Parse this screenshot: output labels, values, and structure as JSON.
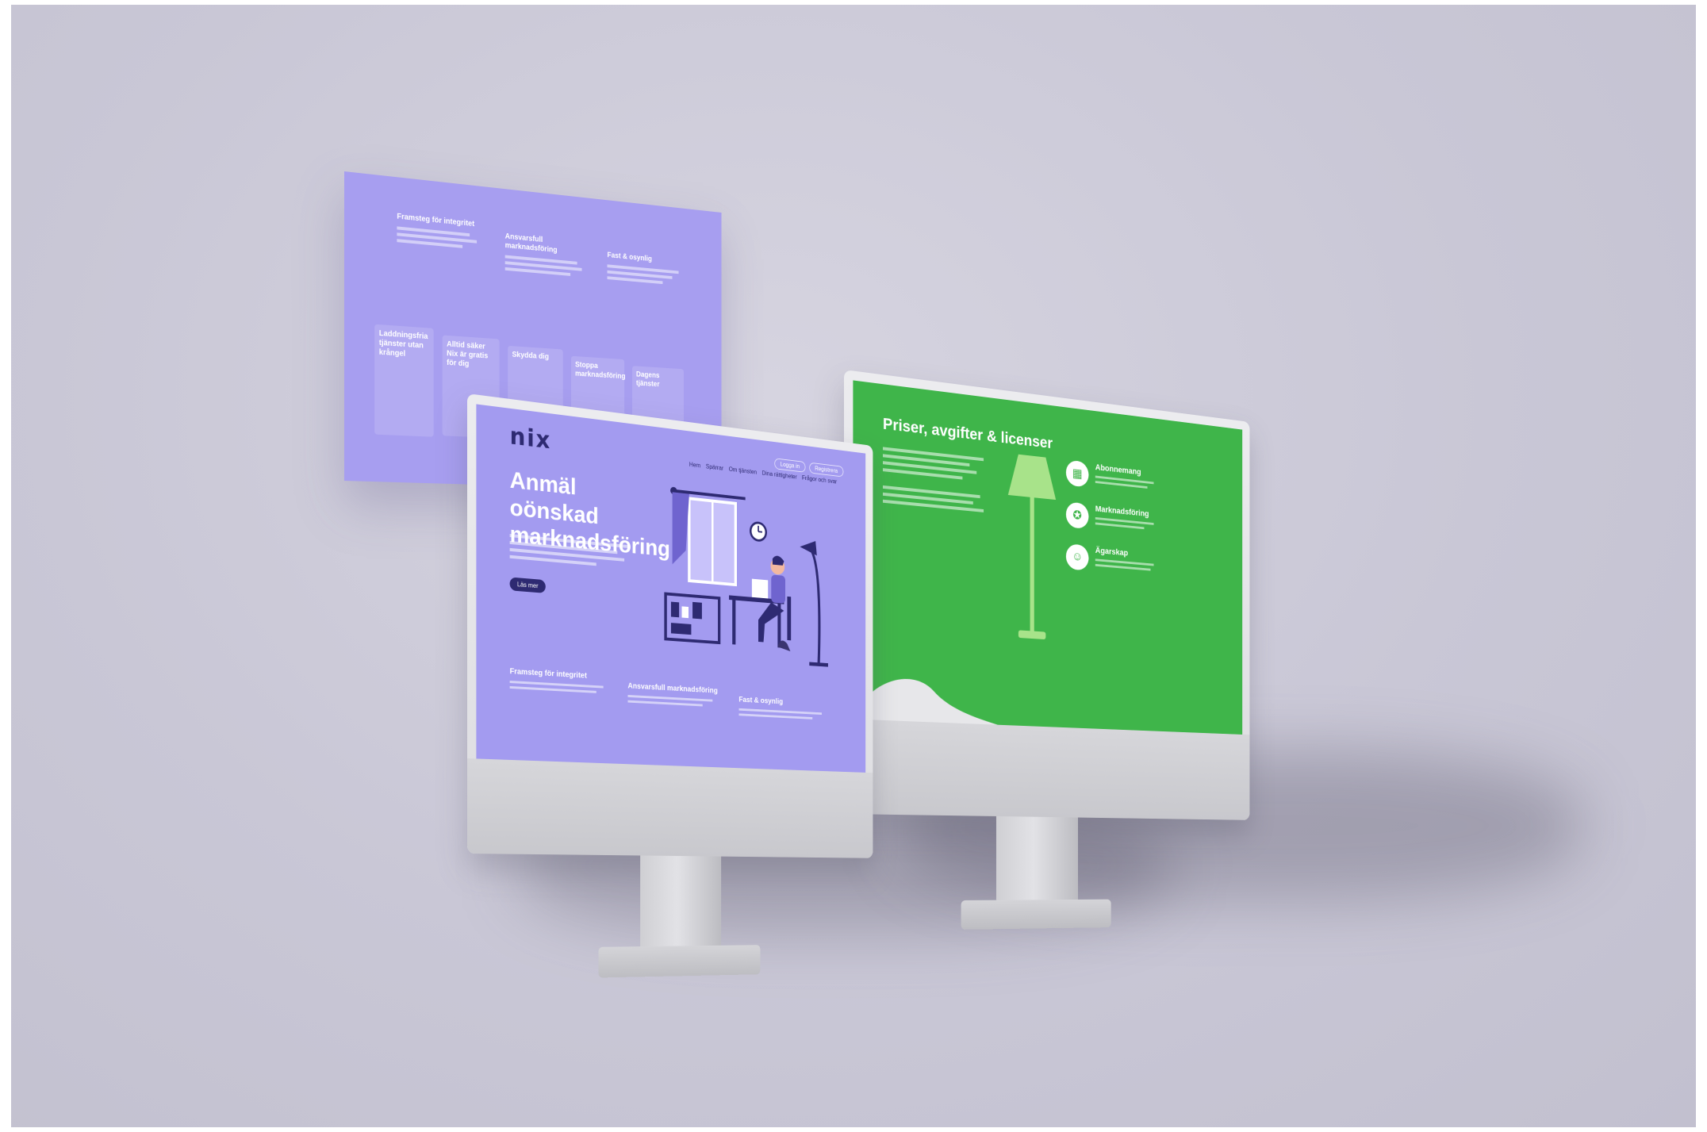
{
  "scene": {
    "background_color": "#c9c7d6"
  },
  "floating_panel": {
    "background_color": "#a79ef0",
    "columns": [
      {
        "title": "Framsteg för integritet",
        "body": ""
      },
      {
        "title": "Ansvarsfull marknadsföring",
        "body": ""
      },
      {
        "title": "Fast & osynlig",
        "body": ""
      }
    ],
    "cards": [
      {
        "title": "Laddningsfria tjänster utan krångel"
      },
      {
        "title": "Alltid säker Nix är gratis för dig"
      },
      {
        "title": "Skydda dig"
      },
      {
        "title": "Stoppa marknadsföring"
      },
      {
        "title": "Dagens tjänster"
      }
    ]
  },
  "front_monitor": {
    "screen_color": "#a39bf0",
    "logo": "nix",
    "nav": [
      "Hem",
      "Spärrar",
      "Om tjänsten",
      "Dina rättigheter",
      "Frågor och svar"
    ],
    "nav_buttons": [
      "Logga in",
      "Registrera"
    ],
    "hero": {
      "title": "Anmäl oönskad marknadsföring",
      "body": "",
      "cta": "Läs mer"
    },
    "bottom_columns": [
      {
        "title": "Framsteg för integritet"
      },
      {
        "title": "Ansvarsfull marknadsföring"
      },
      {
        "title": "Fast & osynlig"
      }
    ]
  },
  "back_monitor": {
    "screen_color": "#3fb54a",
    "title": "Priser, avgifter & licenser",
    "features": [
      {
        "icon": "calendar-icon",
        "title": "Abonnemang"
      },
      {
        "icon": "certificate-icon",
        "title": "Marknadsföring"
      },
      {
        "icon": "user-icon",
        "title": "Ägarskap"
      }
    ]
  }
}
